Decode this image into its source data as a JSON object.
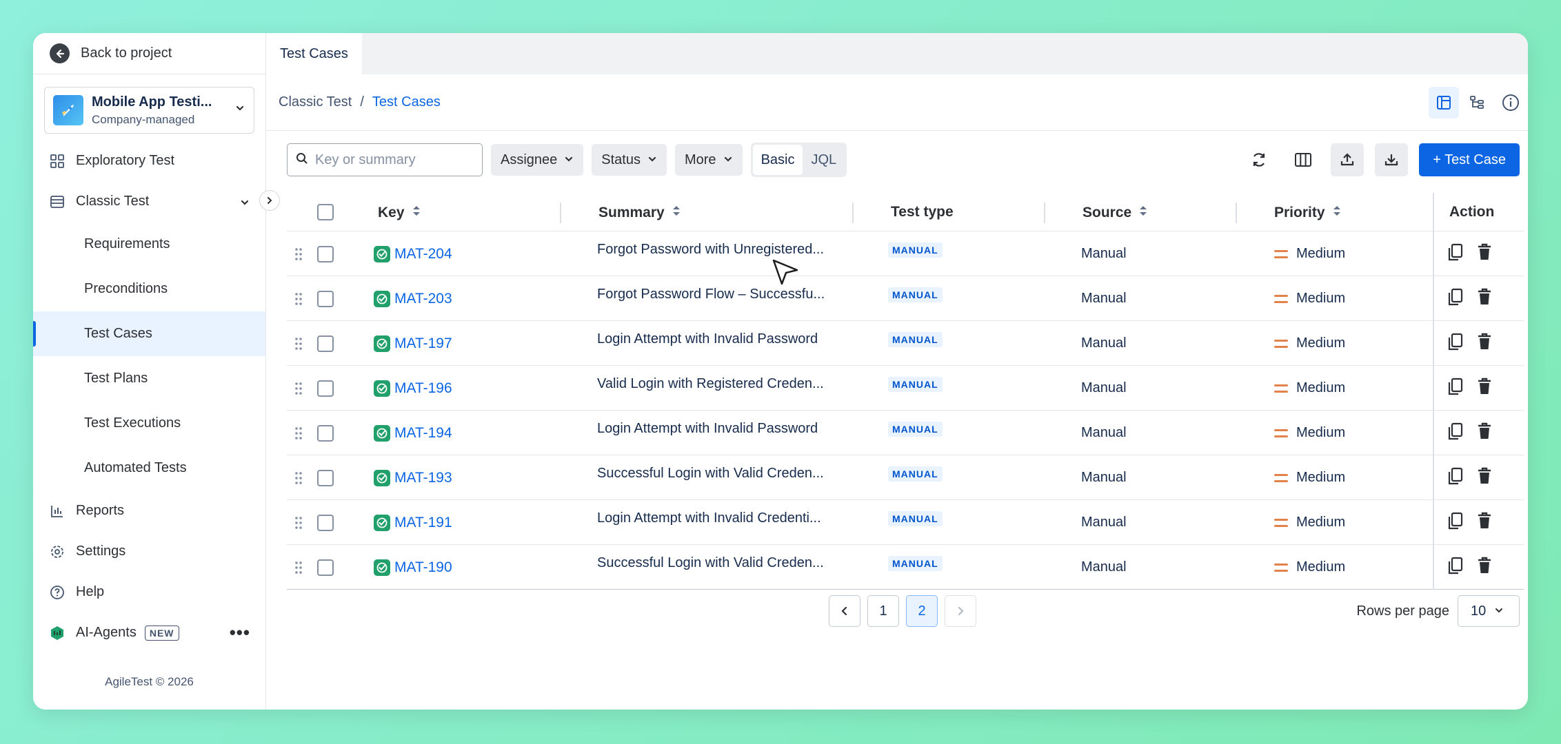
{
  "sidebar": {
    "back_label": "Back to project",
    "project": {
      "name": "Mobile App Testi...",
      "type": "Company-managed"
    },
    "items": [
      {
        "label": "Exploratory Test",
        "icon": "grid-icon"
      },
      {
        "label": "Classic Test",
        "icon": "list-icon"
      },
      {
        "label": "Reports",
        "icon": "chart-icon"
      },
      {
        "label": "Settings",
        "icon": "gear-icon"
      },
      {
        "label": "Help",
        "icon": "help-icon"
      },
      {
        "label": "AI-Agents",
        "icon": "agent-icon",
        "badge": "NEW"
      }
    ],
    "sub_items": [
      {
        "label": "Requirements"
      },
      {
        "label": "Preconditions"
      },
      {
        "label": "Test Cases",
        "active": true
      },
      {
        "label": "Test Plans"
      },
      {
        "label": "Test Executions"
      },
      {
        "label": "Automated Tests"
      }
    ],
    "copyright": "AgileTest © 2026"
  },
  "tabs": {
    "active": "Test Cases"
  },
  "breadcrumb": {
    "parent": "Classic Test",
    "separator": "/",
    "current": "Test Cases"
  },
  "toolbar": {
    "search_placeholder": "Key or summary",
    "filters": [
      "Assignee",
      "Status",
      "More"
    ],
    "mode": {
      "basic": "Basic",
      "jql": "JQL",
      "selected": "Basic"
    },
    "add_button": "+ Test Case"
  },
  "table": {
    "headers": {
      "key": "Key",
      "summary": "Summary",
      "test_type": "Test type",
      "source": "Source",
      "priority": "Priority",
      "action": "Action"
    },
    "rows": [
      {
        "key": "MAT-204",
        "summary": "Forgot Password with Unregistered...",
        "type": "MANUAL",
        "source": "Manual",
        "priority": "Medium"
      },
      {
        "key": "MAT-203",
        "summary": "Forgot Password Flow – Successfu...",
        "type": "MANUAL",
        "source": "Manual",
        "priority": "Medium"
      },
      {
        "key": "MAT-197",
        "summary": "Login Attempt with Invalid Password",
        "type": "MANUAL",
        "source": "Manual",
        "priority": "Medium"
      },
      {
        "key": "MAT-196",
        "summary": "Valid Login with Registered Creden...",
        "type": "MANUAL",
        "source": "Manual",
        "priority": "Medium"
      },
      {
        "key": "MAT-194",
        "summary": "Login Attempt with Invalid Password",
        "type": "MANUAL",
        "source": "Manual",
        "priority": "Medium"
      },
      {
        "key": "MAT-193",
        "summary": "Successful Login with Valid Creden...",
        "type": "MANUAL",
        "source": "Manual",
        "priority": "Medium"
      },
      {
        "key": "MAT-191",
        "summary": "Login Attempt with Invalid Credenti...",
        "type": "MANUAL",
        "source": "Manual",
        "priority": "Medium"
      },
      {
        "key": "MAT-190",
        "summary": "Successful Login with Valid Creden...",
        "type": "MANUAL",
        "source": "Manual",
        "priority": "Medium"
      }
    ]
  },
  "pagination": {
    "pages": [
      "1",
      "2"
    ],
    "current": "2",
    "rows_label": "Rows per page",
    "rows_value": "10"
  },
  "colors": {
    "accent": "#0c66e4",
    "test_icon": "#22a06b",
    "priority_medium": "#e2824a"
  }
}
